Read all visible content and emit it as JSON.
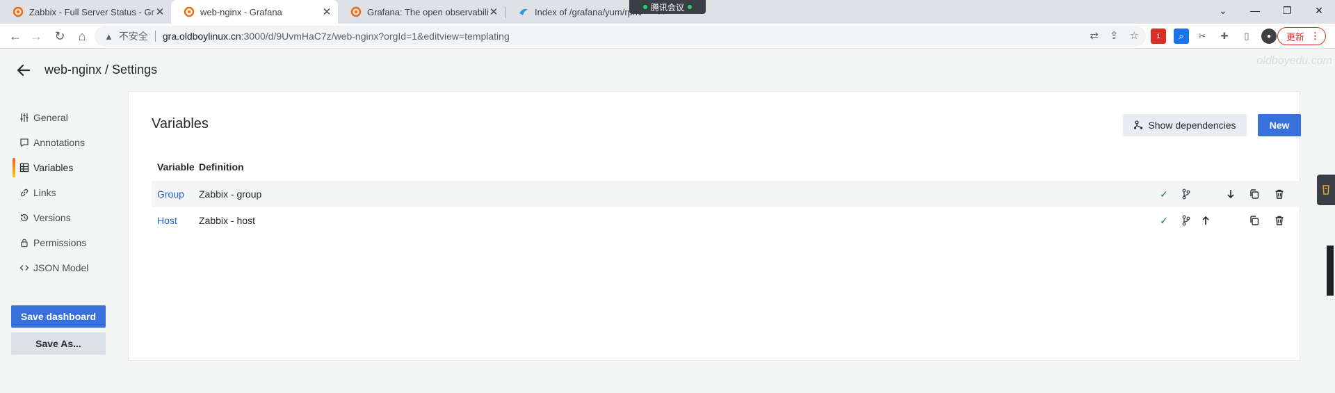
{
  "browser": {
    "tabs": [
      {
        "title": "Zabbix - Full Server Status - Gr",
        "icon": "grafana-icon",
        "active": false
      },
      {
        "title": "web-nginx - Grafana",
        "icon": "grafana-icon",
        "active": true
      },
      {
        "title": "Grafana: The open observabili",
        "icon": "grafana-icon",
        "active": false
      },
      {
        "title": "Index of /grafana/yum/rpm/",
        "icon": "tsinghua-icon",
        "active": false
      }
    ],
    "meeting_label": "腾讯会议",
    "address": {
      "insecure_label": "不安全",
      "host": "gra.oldboylinux.cn",
      "rest": ":3000/d/9UvmHaC7z/web-nginx?orgId=1&editview=templating"
    },
    "update_label": "更新",
    "ext_badge": "1"
  },
  "watermark": "oldboyedu.com",
  "header": {
    "title": "web-nginx / Settings"
  },
  "sidebar": {
    "items": [
      {
        "label": "General",
        "icon": "sliders-icon"
      },
      {
        "label": "Annotations",
        "icon": "comment-icon"
      },
      {
        "label": "Variables",
        "icon": "table-icon",
        "active": true
      },
      {
        "label": "Links",
        "icon": "link-icon"
      },
      {
        "label": "Versions",
        "icon": "history-icon"
      },
      {
        "label": "Permissions",
        "icon": "lock-icon"
      },
      {
        "label": "JSON Model",
        "icon": "code-icon"
      }
    ],
    "save_label": "Save dashboard",
    "save_as_label": "Save As..."
  },
  "variables": {
    "title": "Variables",
    "show_deps_label": "Show dependencies",
    "new_label": "New",
    "columns": [
      "Variable",
      "Definition"
    ],
    "rows": [
      {
        "name": "Group",
        "definition": "Zabbix - group"
      },
      {
        "name": "Host",
        "definition": "Zabbix - host"
      }
    ]
  },
  "colors": {
    "primary": "#3871dc",
    "link": "#1f62e0",
    "success": "#1a7f4b"
  }
}
